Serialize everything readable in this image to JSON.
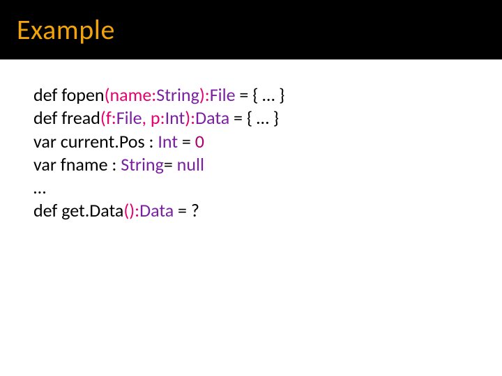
{
  "title": "Example",
  "code": {
    "l1": {
      "def": "def",
      "sp": " ",
      "fn": "fopen",
      "op_paren": "(",
      "param": "name",
      "colon1": ":",
      "ptype": "String",
      "cl_paren": ")",
      "colon2": ":",
      "rtype": "File",
      "eq": " = { … }"
    },
    "l2": {
      "def": "def",
      "sp": " ",
      "fn": "fread",
      "op_paren": "(",
      "p1": "f",
      "c1": ":",
      "t1": "File",
      "comma": ", ",
      "p2": "p",
      "c2": ":",
      "t2": "Int",
      "cl_paren": ")",
      "colon2": ":",
      "rtype": "Data",
      "eq": " = { … }"
    },
    "l3": {
      "var": "var",
      "sp": " ",
      "name": "current.Pos : ",
      "type": "Int",
      "eq": " = ",
      "val": "0"
    },
    "l4": {
      "var": "var",
      "sp": " ",
      "name": "fname : ",
      "type": "String",
      "eq": "= ",
      "val": "null"
    },
    "l5": {
      "dots": "…"
    },
    "l6": {
      "def": "def",
      "sp": " ",
      "fn": "get.Data",
      "op_paren": "(",
      "cl_paren": ")",
      "colon2": ":",
      "rtype": "Data",
      "eq": " = ?"
    }
  }
}
